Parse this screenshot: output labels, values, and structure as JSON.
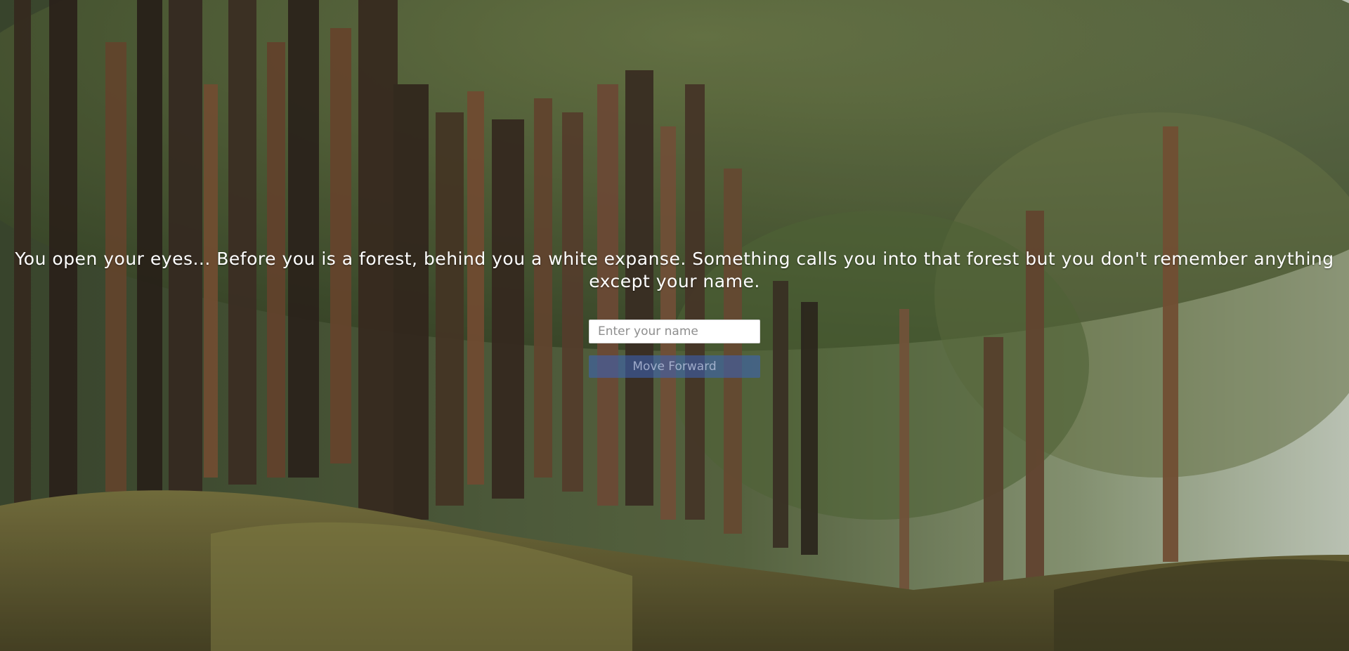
{
  "story": {
    "text": "You open your eyes... Before you is a forest, behind you a white expanse. Something calls you into that forest but you don't remember anything except your name."
  },
  "name_field": {
    "placeholder": "Enter your name",
    "value": ""
  },
  "forward_button": {
    "label": "Move Forward",
    "state": "disabled"
  },
  "background": {
    "description_icon": "forest-background-image"
  }
}
